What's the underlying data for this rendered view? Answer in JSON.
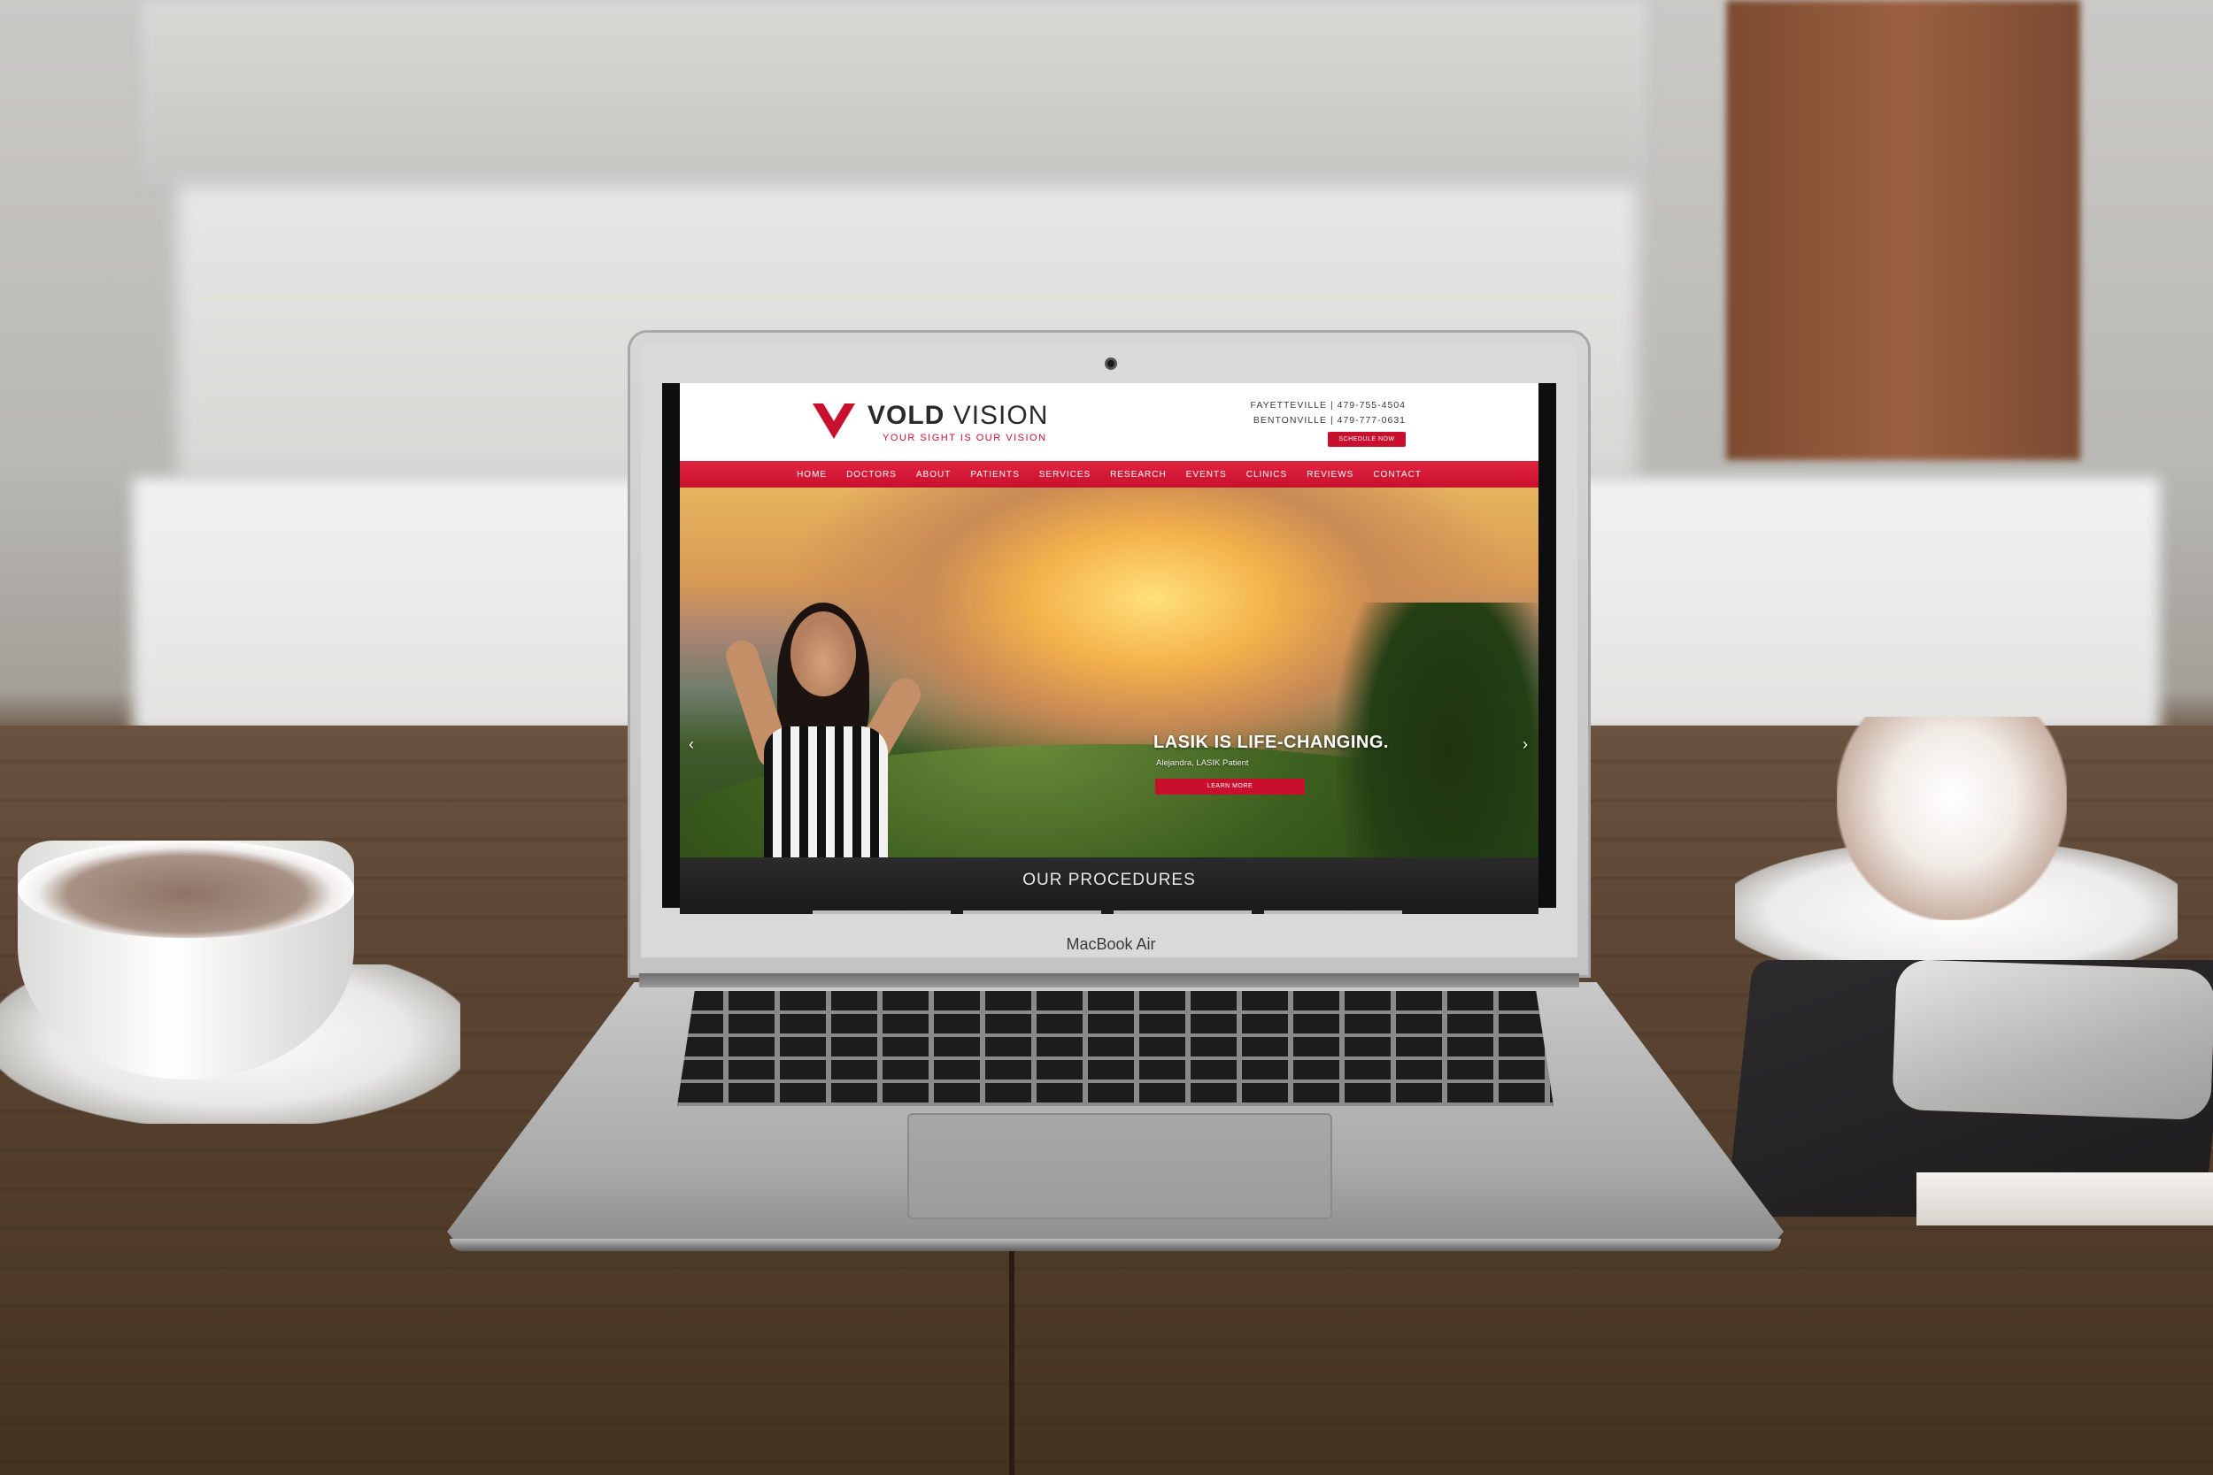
{
  "site": {
    "logo_bold": "VOLD",
    "logo_light": "VISION",
    "tagline": "YOUR SIGHT IS OUR VISION",
    "locations": [
      {
        "city": "FAYETTEVILLE",
        "phone": "479-755-4504"
      },
      {
        "city": "BENTONVILLE",
        "phone": "479-777-0631"
      }
    ],
    "schedule_label": "SCHEDULE NOW",
    "brand_color": "#c8102e"
  },
  "nav": {
    "items": [
      "HOME",
      "DOCTORS",
      "ABOUT",
      "PATIENTS",
      "SERVICES",
      "RESEARCH",
      "EVENTS",
      "CLINICS",
      "REVIEWS",
      "CONTACT"
    ]
  },
  "hero": {
    "title": "LASIK IS LIFE-CHANGING.",
    "caption": "Alejandra, LASIK Patient",
    "cta_label": "LEARN MORE",
    "prev_icon": "chevron-left-icon",
    "next_icon": "chevron-right-icon"
  },
  "procedures": {
    "title": "OUR PROCEDURES"
  },
  "device": {
    "name": "MacBook Air"
  }
}
